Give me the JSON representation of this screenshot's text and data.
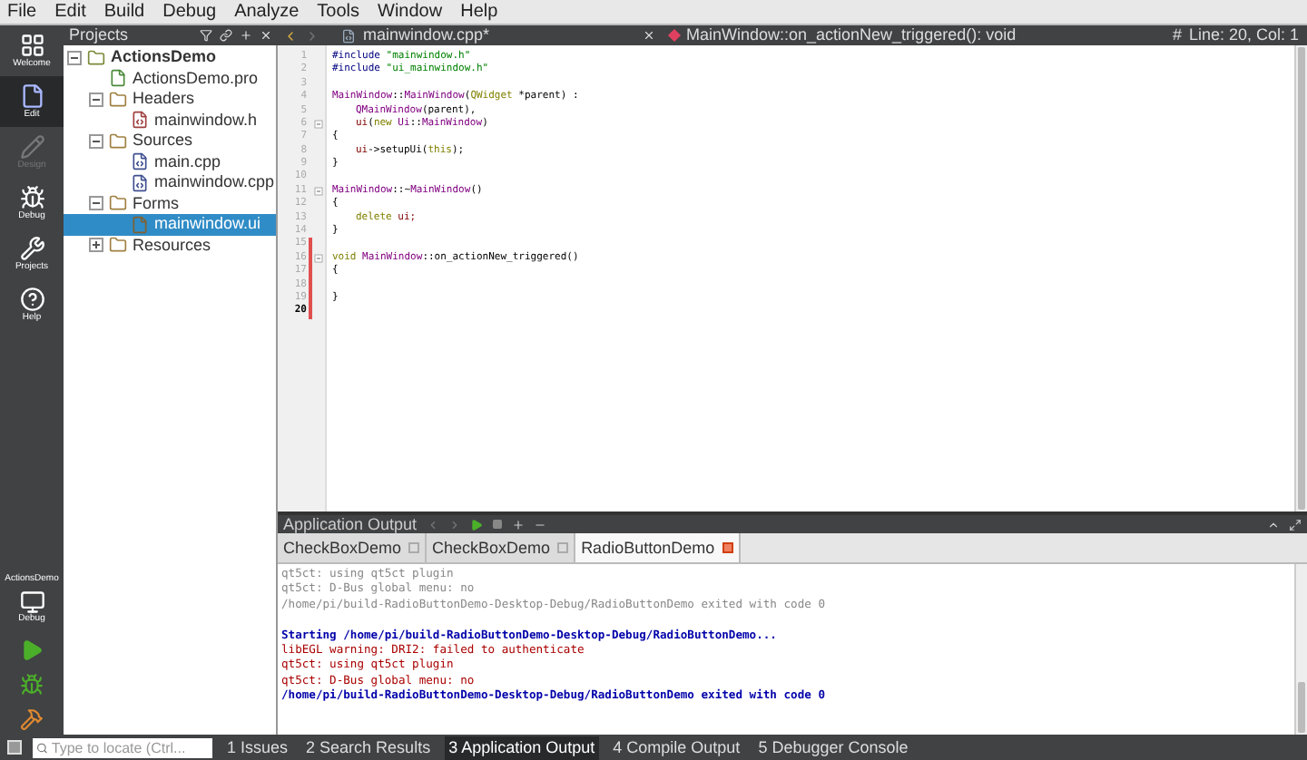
{
  "menu": [
    "File",
    "Edit",
    "Build",
    "Debug",
    "Analyze",
    "Tools",
    "Window",
    "Help"
  ],
  "modes": [
    {
      "label": "Welcome",
      "kind": "welcome",
      "selected": false,
      "disabled": false
    },
    {
      "label": "Edit",
      "kind": "edit",
      "selected": true,
      "disabled": false
    },
    {
      "label": "Design",
      "kind": "design",
      "selected": false,
      "disabled": true
    },
    {
      "label": "Debug",
      "kind": "debug",
      "selected": false,
      "disabled": false
    },
    {
      "label": "Projects",
      "kind": "projects",
      "selected": false,
      "disabled": false
    },
    {
      "label": "Help",
      "kind": "help",
      "selected": false,
      "disabled": false
    }
  ],
  "kit": {
    "project": "ActionsDemo",
    "mode": "Debug"
  },
  "projects": {
    "title": "Projects",
    "tree": [
      {
        "label": "ActionsDemo",
        "kind": "project",
        "expanded": true,
        "selected": false,
        "children": [
          {
            "label": "ActionsDemo.pro",
            "kind": "pro",
            "selected": false
          },
          {
            "label": "Headers",
            "kind": "folder",
            "expanded": true,
            "selected": false,
            "children": [
              {
                "label": "mainwindow.h",
                "kind": "header",
                "selected": false
              }
            ]
          },
          {
            "label": "Sources",
            "kind": "folder",
            "expanded": true,
            "selected": false,
            "children": [
              {
                "label": "main.cpp",
                "kind": "source",
                "selected": false
              },
              {
                "label": "mainwindow.cpp",
                "kind": "source",
                "selected": false
              }
            ]
          },
          {
            "label": "Forms",
            "kind": "folder",
            "expanded": true,
            "selected": false,
            "children": [
              {
                "label": "mainwindow.ui",
                "kind": "form",
                "selected": true
              }
            ]
          },
          {
            "label": "Resources",
            "kind": "folder",
            "expanded": false,
            "selected": false
          }
        ]
      }
    ]
  },
  "editor": {
    "file": "mainwindow.cpp*",
    "symbol": "MainWindow::on_actionNew_triggered(): void",
    "hash": "#",
    "position": "Line: 20, Col: 1",
    "lines": [
      {
        "n": "1",
        "fold": false,
        "changed": false,
        "current": false,
        "indent": false,
        "seg": [
          {
            "text": "#include",
            "kind": "pre"
          },
          {
            "text": " \"mainwindow.h\"",
            "kind": "str"
          }
        ]
      },
      {
        "n": "2",
        "fold": false,
        "changed": false,
        "current": false,
        "indent": false,
        "seg": [
          {
            "text": "#include",
            "kind": "pre"
          },
          {
            "text": " \"ui_mainwindow.h\"",
            "kind": "str"
          }
        ]
      },
      {
        "n": "3",
        "fold": false,
        "changed": false,
        "current": false,
        "indent": false
      },
      {
        "n": "4",
        "fold": false,
        "changed": false,
        "current": false,
        "indent": false,
        "seg": [
          {
            "text": "MainWindow",
            "kind": "type"
          },
          {
            "text": "::",
            "kind": "plain"
          },
          {
            "text": "MainWindow",
            "kind": "type"
          },
          {
            "text": "(",
            "kind": "plain"
          },
          {
            "text": "QWidget",
            "kind": "kw"
          },
          {
            "text": " *parent) :",
            "kind": "plain"
          }
        ]
      },
      {
        "n": "5",
        "fold": false,
        "changed": false,
        "current": false,
        "indent": true,
        "seg": [
          {
            "text": "QMainWindow",
            "kind": "type"
          },
          {
            "text": "(parent),",
            "kind": "plain"
          }
        ]
      },
      {
        "n": "6",
        "fold": true,
        "changed": false,
        "current": false,
        "indent": true,
        "seg": [
          {
            "text": "ui",
            "kind": "var"
          },
          {
            "text": "(",
            "kind": "plain"
          },
          {
            "text": "new",
            "kind": "kw"
          },
          {
            "text": " Ui",
            "kind": "type"
          },
          {
            "text": "::",
            "kind": "plain"
          },
          {
            "text": "MainWindow",
            "kind": "type"
          },
          {
            "text": ")",
            "kind": "plain"
          }
        ]
      },
      {
        "n": "7",
        "fold": false,
        "changed": false,
        "current": false,
        "indent": false,
        "seg": [
          {
            "text": "{",
            "kind": "plain"
          }
        ]
      },
      {
        "n": "8",
        "fold": false,
        "changed": false,
        "current": false,
        "indent": true,
        "seg": [
          {
            "text": "ui",
            "kind": "var"
          },
          {
            "text": "->setupUi(",
            "kind": "plain"
          },
          {
            "text": "this",
            "kind": "kw"
          },
          {
            "text": ");",
            "kind": "plain"
          }
        ]
      },
      {
        "n": "9",
        "fold": false,
        "changed": false,
        "current": false,
        "indent": false,
        "seg": [
          {
            "text": "}",
            "kind": "plain"
          }
        ]
      },
      {
        "n": "10",
        "fold": false,
        "changed": false,
        "current": false,
        "indent": false
      },
      {
        "n": "11",
        "fold": true,
        "changed": false,
        "current": false,
        "indent": false,
        "seg": [
          {
            "text": "MainWindow",
            "kind": "type"
          },
          {
            "text": "::~",
            "kind": "plain"
          },
          {
            "text": "MainWindow",
            "kind": "type"
          },
          {
            "text": "()",
            "kind": "plain"
          }
        ]
      },
      {
        "n": "12",
        "fold": false,
        "changed": false,
        "current": false,
        "indent": false,
        "seg": [
          {
            "text": "{",
            "kind": "plain"
          }
        ]
      },
      {
        "n": "13",
        "fold": false,
        "changed": false,
        "current": false,
        "indent": true,
        "seg": [
          {
            "text": "delete",
            "kind": "kw"
          },
          {
            "text": " ui;",
            "kind": "var"
          }
        ]
      },
      {
        "n": "14",
        "fold": false,
        "changed": false,
        "current": false,
        "indent": false,
        "seg": [
          {
            "text": "}",
            "kind": "plain"
          }
        ]
      },
      {
        "n": "15",
        "fold": false,
        "changed": true,
        "current": false,
        "indent": false
      },
      {
        "n": "16",
        "fold": true,
        "changed": true,
        "current": false,
        "indent": false,
        "seg": [
          {
            "text": "void",
            "kind": "kw"
          },
          {
            "text": " MainWindow",
            "kind": "type"
          },
          {
            "text": "::on_actionNew_triggered()",
            "kind": "plain"
          }
        ]
      },
      {
        "n": "17",
        "fold": false,
        "changed": true,
        "current": false,
        "indent": false,
        "seg": [
          {
            "text": "{",
            "kind": "plain"
          }
        ]
      },
      {
        "n": "18",
        "fold": false,
        "changed": true,
        "current": false,
        "indent": false
      },
      {
        "n": "19",
        "fold": false,
        "changed": true,
        "current": false,
        "indent": false,
        "seg": [
          {
            "text": "}",
            "kind": "plain"
          }
        ]
      },
      {
        "n": "20",
        "fold": false,
        "changed": true,
        "current": true,
        "indent": false
      }
    ]
  },
  "output": {
    "title": "Application Output",
    "tabs": [
      {
        "label": "CheckBoxDemo",
        "selected": false
      },
      {
        "label": "CheckBoxDemo",
        "selected": false
      },
      {
        "label": "RadioButtonDemo",
        "selected": true
      }
    ],
    "lines": [
      {
        "text": "qt5ct: using qt5ct plugin",
        "kind": "old"
      },
      {
        "text": "qt5ct: D-Bus global menu: no",
        "kind": "old"
      },
      {
        "text": "/home/pi/build-RadioButtonDemo-Desktop-Debug/RadioButtonDemo exited with code 0",
        "kind": "old"
      },
      {
        "kind": "blank"
      },
      {
        "text": "Starting /home/pi/build-RadioButtonDemo-Desktop-Debug/RadioButtonDemo...",
        "kind": "info"
      },
      {
        "text": "libEGL warning: DRI2: failed to authenticate",
        "kind": "error"
      },
      {
        "text": "qt5ct: using qt5ct plugin",
        "kind": "error"
      },
      {
        "text": "qt5ct: D-Bus global menu: no",
        "kind": "error"
      },
      {
        "text": "/home/pi/build-RadioButtonDemo-Desktop-Debug/RadioButtonDemo exited with code 0",
        "kind": "info"
      }
    ]
  },
  "status": {
    "locate_placeholder": "Type to locate (Ctrl...",
    "panes": [
      {
        "label": "1 Issues",
        "selected": false
      },
      {
        "label": "2 Search Results",
        "selected": false
      },
      {
        "label": "3 Application Output",
        "selected": true
      },
      {
        "label": "4 Compile Output",
        "selected": false
      },
      {
        "label": "5 Debugger Console",
        "selected": false
      }
    ]
  }
}
